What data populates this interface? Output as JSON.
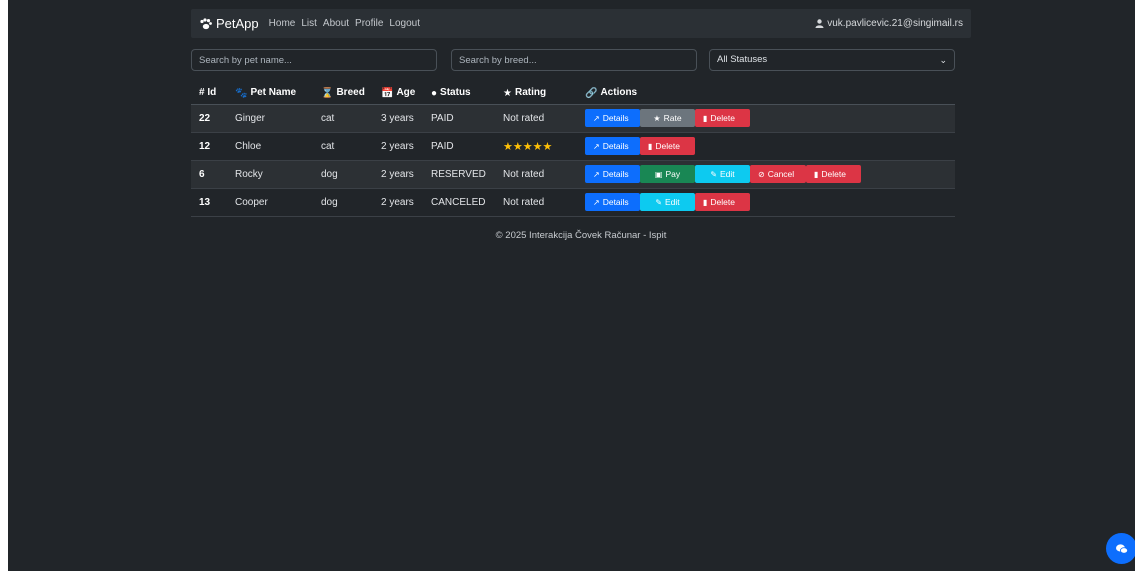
{
  "navbar": {
    "brand": "PetApp",
    "links": [
      "Home",
      "List",
      "About",
      "Profile",
      "Logout"
    ],
    "user": "vuk.pavlicevic.21@singimail.rs"
  },
  "filters": {
    "name_placeholder": "Search by pet name...",
    "breed_placeholder": "Search by breed...",
    "status_selected": "All Statuses"
  },
  "table": {
    "headers": [
      "# Id",
      "Pet Name",
      "Breed",
      "Age",
      "Status",
      "Rating",
      "Actions"
    ],
    "rows": [
      {
        "id": "22",
        "name": "Ginger",
        "breed": "cat",
        "age": "3 years",
        "status": "PAID",
        "rating": "Not rated",
        "stars": 0
      },
      {
        "id": "12",
        "name": "Chloe",
        "breed": "cat",
        "age": "2 years",
        "status": "PAID",
        "rating": "",
        "stars": 5
      },
      {
        "id": "6",
        "name": "Rocky",
        "breed": "dog",
        "age": "2 years",
        "status": "RESERVED",
        "rating": "Not rated",
        "stars": 0
      },
      {
        "id": "13",
        "name": "Cooper",
        "breed": "dog",
        "age": "2 years",
        "status": "CANCELED",
        "rating": "Not rated",
        "stars": 0
      }
    ]
  },
  "actions": {
    "details": "Details",
    "rate": "Rate",
    "delete": "Delete",
    "pay": "Pay",
    "edit": "Edit",
    "cancel": "Cancel"
  },
  "footer": "© 2025 Interakcija Čovek Računar - Ispit",
  "colors": {
    "background": "#212529",
    "primary": "#0d6efd",
    "danger": "#dc3545",
    "secondary": "#6c757d",
    "success": "#198754",
    "info": "#0dcaf0",
    "star": "#ffc107"
  }
}
